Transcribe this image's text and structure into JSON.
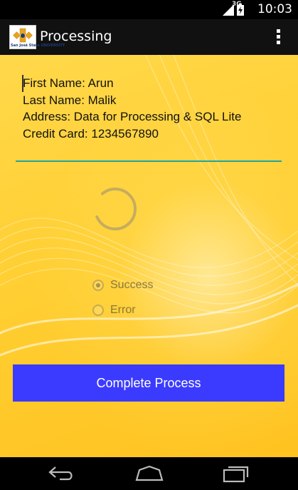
{
  "status_bar": {
    "network": "3G",
    "time": "10:03",
    "icons": [
      "signal-icon",
      "battery-icon"
    ]
  },
  "action_bar": {
    "title": "Processing",
    "logo_text": "San José State UNIVERSITY"
  },
  "form": {
    "lines": [
      "First Name: Arun",
      "Last Name: Malik",
      "Address: Data for Processing & SQL Lite",
      "Credit Card: 1234567890"
    ]
  },
  "radios": {
    "success_label": "Success",
    "error_label": "Error",
    "selected": "Success"
  },
  "button": {
    "complete_label": "Complete Process"
  },
  "colors": {
    "background": "#ffcc33",
    "button": "#3b3bff",
    "underline": "#1fa6a0"
  },
  "nav": [
    "back-icon",
    "home-icon",
    "recents-icon"
  ]
}
